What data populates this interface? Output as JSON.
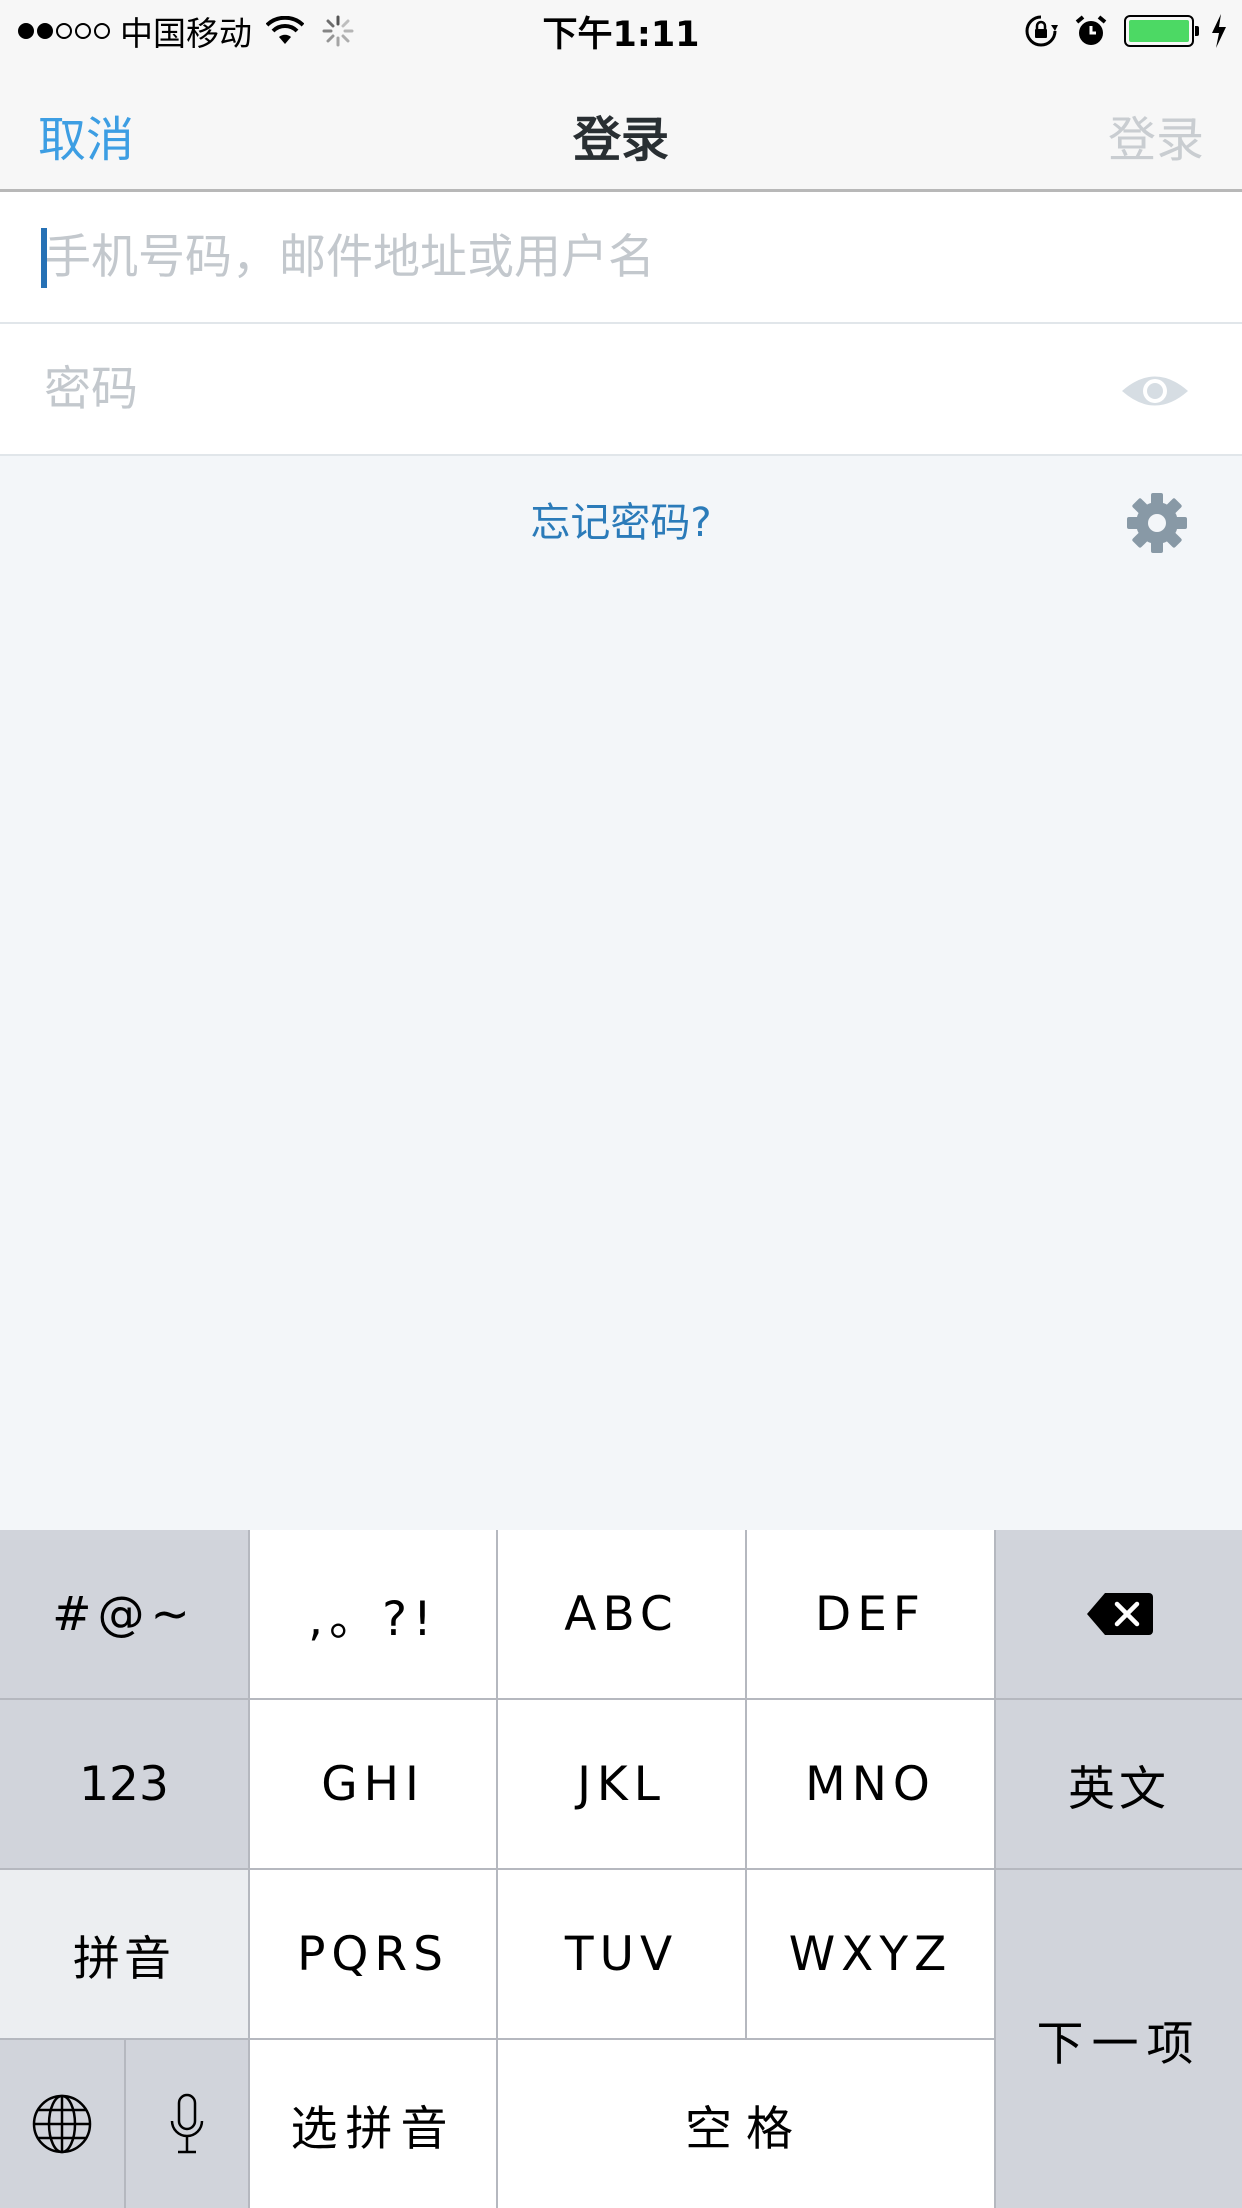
{
  "status_bar": {
    "carrier": "中国移动",
    "time": "下午1:11",
    "signal_bars_filled": 2,
    "signal_bars_total": 5,
    "battery_level": 1.0,
    "battery_color": "#4cd964"
  },
  "nav": {
    "cancel_label": "取消",
    "title": "登录",
    "login_label": "登录"
  },
  "form": {
    "username_placeholder": "手机号码，邮件地址或用户名",
    "username_value": "",
    "password_placeholder": "密码",
    "password_value": "",
    "forgot_label": "忘记密码?"
  },
  "keyboard": {
    "symbols": "#@~",
    "punct": ",。?!",
    "abc": "ABC",
    "def": "DEF",
    "num": "123",
    "ghi": "GHI",
    "jkl": "JKL",
    "mno": "MNO",
    "english": "英文",
    "pinyin": "拼音",
    "pqrs": "PQRS",
    "tuv": "TUV",
    "wxyz": "WXYZ",
    "next": "下一项",
    "select_pinyin": "选拼音",
    "space": "空格"
  },
  "colors": {
    "accent": "#3d9ee3",
    "link": "#2b7bb9",
    "disabled": "#c9cdd1",
    "background": "#f3f6f9"
  },
  "icons": [
    "wifi-icon",
    "spinner-icon",
    "rotation-lock-icon",
    "alarm-icon",
    "battery-icon",
    "charging-icon",
    "eye-icon",
    "gear-icon",
    "backspace-icon",
    "globe-icon",
    "microphone-icon"
  ]
}
